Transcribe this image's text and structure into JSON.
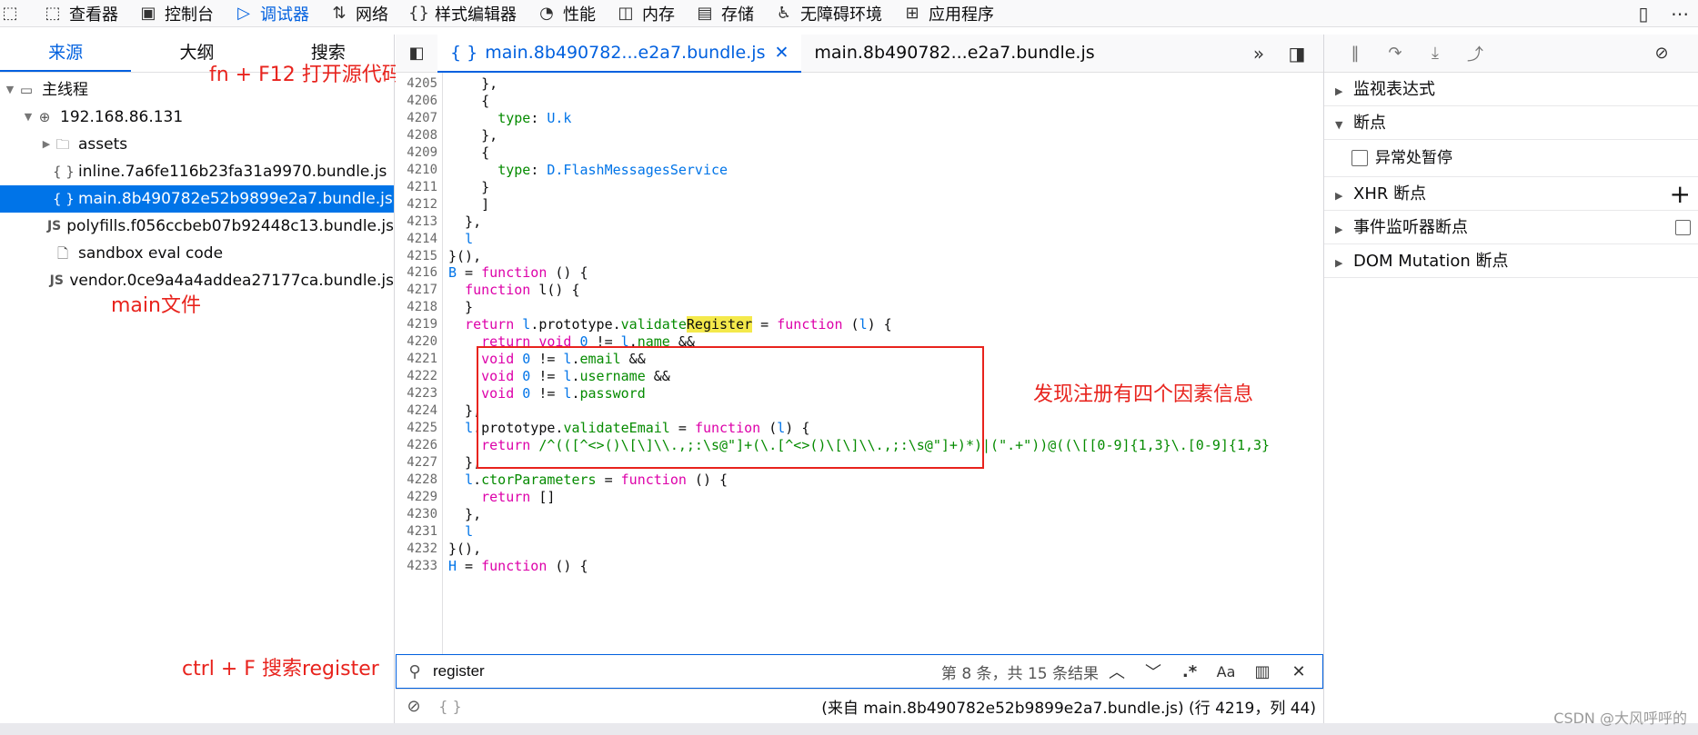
{
  "toolbar": {
    "items": [
      {
        "label": "查看器",
        "icon": "inspector-icon"
      },
      {
        "label": "控制台",
        "icon": "console-icon"
      },
      {
        "label": "调试器",
        "icon": "debugger-icon",
        "active": true
      },
      {
        "label": "网络",
        "icon": "network-icon"
      },
      {
        "label": "样式编辑器",
        "icon": "style-editor-icon"
      },
      {
        "label": "性能",
        "icon": "performance-icon"
      },
      {
        "label": "内存",
        "icon": "memory-icon"
      },
      {
        "label": "存储",
        "icon": "storage-icon"
      },
      {
        "label": "无障碍环境",
        "icon": "accessibility-icon"
      },
      {
        "label": "应用程序",
        "icon": "application-icon"
      }
    ]
  },
  "left": {
    "tabs": [
      "来源",
      "大纲",
      "搜索"
    ],
    "tree": [
      {
        "label": "主线程",
        "icon": "window-icon",
        "indent": 0,
        "twisty": "open"
      },
      {
        "label": "192.168.86.131",
        "icon": "globe-icon",
        "indent": 1,
        "twisty": "open"
      },
      {
        "label": "assets",
        "icon": "folder-icon",
        "indent": 2,
        "twisty": "closed"
      },
      {
        "label": "inline.7a6fe116b23fa31a9970.bundle.js",
        "icon": "braces-icon",
        "indent": 2
      },
      {
        "label": "main.8b490782e52b9899e2a7.bundle.js",
        "icon": "braces-icon",
        "indent": 2,
        "selected": true
      },
      {
        "label": "polyfills.f056ccbeb07b92448c13.bundle.js",
        "icon": "js-icon",
        "indent": 2
      },
      {
        "label": "sandbox eval code",
        "icon": "file-icon",
        "indent": 2
      },
      {
        "label": "vendor.0ce9a4a4addea27177ca.bundle.js",
        "icon": "js-icon",
        "indent": 2
      }
    ]
  },
  "annotations": {
    "open_source": "fn + F12 打开源代码",
    "main_file": "main文件",
    "search_hint": "ctrl + F 搜索register",
    "finding": "发现注册有四个因素信息"
  },
  "editor": {
    "tabs": [
      {
        "label": "main.8b490782...e2a7.bundle.js",
        "active": true
      },
      {
        "label": "main.8b490782...e2a7.bundle.js",
        "active": false
      }
    ],
    "code_lines": [
      {
        "n": "4205",
        "indent": "    ",
        "t": "},"
      },
      {
        "n": "4206",
        "indent": "    ",
        "t": "{"
      },
      {
        "n": "4207",
        "indent": "      ",
        "t": "type: U.k"
      },
      {
        "n": "4208",
        "indent": "    ",
        "t": "},"
      },
      {
        "n": "4209",
        "indent": "    ",
        "t": "{"
      },
      {
        "n": "4210",
        "indent": "      ",
        "t": "type: D.FlashMessagesService"
      },
      {
        "n": "4211",
        "indent": "    ",
        "t": "}"
      },
      {
        "n": "4212",
        "indent": "    ",
        "t": "]"
      },
      {
        "n": "4213",
        "indent": "  ",
        "t": "},"
      },
      {
        "n": "4214",
        "indent": "  ",
        "t": "l"
      },
      {
        "n": "4215",
        "indent": "",
        "t": "}(),"
      },
      {
        "n": "4216",
        "indent": "",
        "t": "B = function () {"
      },
      {
        "n": "4217",
        "indent": "  ",
        "t": "function l() {"
      },
      {
        "n": "4218",
        "indent": "  ",
        "t": "}"
      },
      {
        "n": "4219",
        "indent": "  ",
        "t": "return l.prototype.validateRegister = function (l) {"
      },
      {
        "n": "4220",
        "indent": "    ",
        "t": "return void 0 != l.name &&"
      },
      {
        "n": "4221",
        "indent": "    ",
        "t": "void 0 != l.email &&"
      },
      {
        "n": "4222",
        "indent": "    ",
        "t": "void 0 != l.username &&"
      },
      {
        "n": "4223",
        "indent": "    ",
        "t": "void 0 != l.password"
      },
      {
        "n": "4224",
        "indent": "  ",
        "t": "},"
      },
      {
        "n": "4225",
        "indent": "  ",
        "t": "l.prototype.validateEmail = function (l) {"
      },
      {
        "n": "4226",
        "indent": "    ",
        "t": "return /^(([^<>()\\[\\]\\\\.,;:\\s@\"]+(\\.[^<>()\\[\\]\\\\.,;:\\s@\"]+)*)|(\".+\"))@((\\[[0-9]{1,3}\\.[0-9]{1,3}"
      },
      {
        "n": "4227",
        "indent": "  ",
        "t": "},"
      },
      {
        "n": "4228",
        "indent": "  ",
        "t": "l.ctorParameters = function () {"
      },
      {
        "n": "4229",
        "indent": "    ",
        "t": "return []"
      },
      {
        "n": "4230",
        "indent": "  ",
        "t": "},"
      },
      {
        "n": "4231",
        "indent": "  ",
        "t": "l"
      },
      {
        "n": "4232",
        "indent": "",
        "t": "}(),"
      },
      {
        "n": "4233",
        "indent": "",
        "t": "H = function () {"
      }
    ],
    "search": {
      "value": "register",
      "count": "第 8 条，共 15 条结果"
    },
    "status": {
      "position": "(来自 main.8b490782e52b9899e2a7.bundle.js)  (行 4219，列 44)",
      "brace": "{ }"
    }
  },
  "right": {
    "sections": [
      {
        "label": "监视表达式",
        "open": false
      },
      {
        "label": "断点",
        "open": true
      },
      {
        "label": "XHR 断点",
        "open": false,
        "extra": "plus"
      },
      {
        "label": "事件监听器断点",
        "open": false,
        "extra": "checkbox"
      },
      {
        "label": "DOM Mutation 断点",
        "open": false
      }
    ],
    "pause_on_exceptions": "异常处暂停"
  },
  "watermark": "CSDN @大风呼呼的"
}
